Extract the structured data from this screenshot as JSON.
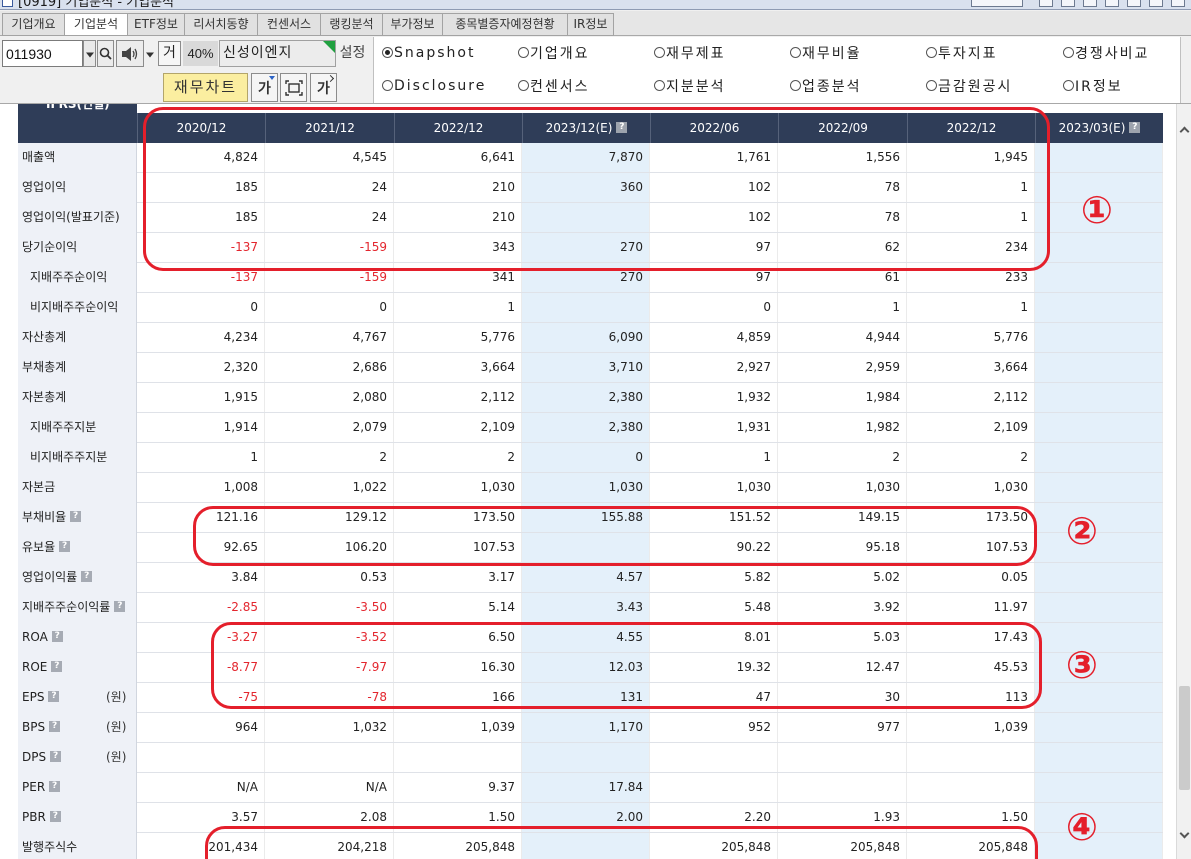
{
  "window": {
    "title": "[0919] 기업분석 - 기업분석"
  },
  "tabs": [
    {
      "label": "기업개요"
    },
    {
      "label": "기업분석",
      "active": true
    },
    {
      "label": "ETF정보"
    },
    {
      "label": "리서치동향"
    },
    {
      "label": "컨센서스"
    },
    {
      "label": "랭킹분석"
    },
    {
      "label": "부가정보"
    },
    {
      "label": "종목별증자예정현황"
    },
    {
      "label": "IR정보"
    }
  ],
  "toolbar": {
    "stock_code": "011930",
    "quote_button": "거",
    "ratio": "40%",
    "company_name": "신성이엔지",
    "settings_label": "설정",
    "chart_button": "재무차트",
    "font_button": "가",
    "font_button_2": "가"
  },
  "view_options": [
    {
      "label": "Snapshot",
      "selected": true
    },
    {
      "label": "기업개요"
    },
    {
      "label": "재무제표"
    },
    {
      "label": "재무비율"
    },
    {
      "label": "투자지표"
    },
    {
      "label": "경쟁사비교"
    },
    {
      "label": "Disclosure"
    },
    {
      "label": "컨센서스"
    },
    {
      "label": "지분분석"
    },
    {
      "label": "업종분석"
    },
    {
      "label": "금감원공시"
    },
    {
      "label": "IR정보"
    }
  ],
  "table": {
    "corner_label": "IFRS(연결)",
    "columns": [
      {
        "label": "2020/12"
      },
      {
        "label": "2021/12"
      },
      {
        "label": "2022/12"
      },
      {
        "label": "2023/12(E)",
        "estimate": true,
        "help": true
      },
      {
        "label": "2022/06"
      },
      {
        "label": "2022/09"
      },
      {
        "label": "2022/12"
      },
      {
        "label": "2023/03(E)",
        "estimate": true,
        "help": true
      }
    ],
    "rows": [
      {
        "label": "매출액",
        "values": [
          "4,824",
          "4,545",
          "6,641",
          "7,870",
          "1,761",
          "1,556",
          "1,945",
          ""
        ]
      },
      {
        "label": "영업이익",
        "values": [
          "185",
          "24",
          "210",
          "360",
          "102",
          "78",
          "1",
          ""
        ]
      },
      {
        "label": "영업이익(발표기준)",
        "values": [
          "185",
          "24",
          "210",
          "",
          "102",
          "78",
          "1",
          ""
        ]
      },
      {
        "label": "당기순이익",
        "values": [
          "-137",
          "-159",
          "343",
          "270",
          "97",
          "62",
          "234",
          ""
        ]
      },
      {
        "label": "지배주주순이익",
        "indent": true,
        "values": [
          "-137",
          "-159",
          "341",
          "270",
          "97",
          "61",
          "233",
          ""
        ]
      },
      {
        "label": "비지배주주순이익",
        "indent": true,
        "values": [
          "0",
          "0",
          "1",
          "",
          "0",
          "1",
          "1",
          ""
        ]
      },
      {
        "label": "자산총계",
        "values": [
          "4,234",
          "4,767",
          "5,776",
          "6,090",
          "4,859",
          "4,944",
          "5,776",
          ""
        ]
      },
      {
        "label": "부채총계",
        "values": [
          "2,320",
          "2,686",
          "3,664",
          "3,710",
          "2,927",
          "2,959",
          "3,664",
          ""
        ]
      },
      {
        "label": "자본총계",
        "values": [
          "1,915",
          "2,080",
          "2,112",
          "2,380",
          "1,932",
          "1,984",
          "2,112",
          ""
        ]
      },
      {
        "label": "지배주주지분",
        "indent": true,
        "values": [
          "1,914",
          "2,079",
          "2,109",
          "2,380",
          "1,931",
          "1,982",
          "2,109",
          ""
        ]
      },
      {
        "label": "비지배주주지분",
        "indent": true,
        "values": [
          "1",
          "2",
          "2",
          "0",
          "1",
          "2",
          "2",
          ""
        ]
      },
      {
        "label": "자본금",
        "values": [
          "1,008",
          "1,022",
          "1,030",
          "1,030",
          "1,030",
          "1,030",
          "1,030",
          ""
        ]
      },
      {
        "label": "부채비율",
        "help": true,
        "values": [
          "121.16",
          "129.12",
          "173.50",
          "155.88",
          "151.52",
          "149.15",
          "173.50",
          ""
        ]
      },
      {
        "label": "유보율",
        "help": true,
        "values": [
          "92.65",
          "106.20",
          "107.53",
          "",
          "90.22",
          "95.18",
          "107.53",
          ""
        ]
      },
      {
        "label": "영업이익률",
        "help": true,
        "values": [
          "3.84",
          "0.53",
          "3.17",
          "4.57",
          "5.82",
          "5.02",
          "0.05",
          ""
        ]
      },
      {
        "label": "지배주주순이익률",
        "help": true,
        "values": [
          "-2.85",
          "-3.50",
          "5.14",
          "3.43",
          "5.48",
          "3.92",
          "11.97",
          ""
        ]
      },
      {
        "label": "ROA",
        "help": true,
        "values": [
          "-3.27",
          "-3.52",
          "6.50",
          "4.55",
          "8.01",
          "5.03",
          "17.43",
          ""
        ]
      },
      {
        "label": "ROE",
        "help": true,
        "values": [
          "-8.77",
          "-7.97",
          "16.30",
          "12.03",
          "19.32",
          "12.47",
          "45.53",
          ""
        ]
      },
      {
        "label": "EPS",
        "help": true,
        "unit": "(원)",
        "values": [
          "-75",
          "-78",
          "166",
          "131",
          "47",
          "30",
          "113",
          ""
        ]
      },
      {
        "label": "BPS",
        "help": true,
        "unit": "(원)",
        "values": [
          "964",
          "1,032",
          "1,039",
          "1,170",
          "952",
          "977",
          "1,039",
          ""
        ]
      },
      {
        "label": "DPS",
        "help": true,
        "unit": "(원)",
        "values": [
          "",
          "",
          "",
          "",
          "",
          "",
          "",
          ""
        ]
      },
      {
        "label": "PER",
        "help": true,
        "values": [
          "N/A",
          "N/A",
          "9.37",
          "17.84",
          "",
          "",
          "",
          ""
        ]
      },
      {
        "label": "PBR",
        "help": true,
        "values": [
          "3.57",
          "2.08",
          "1.50",
          "2.00",
          "2.20",
          "1.93",
          "1.50",
          ""
        ]
      },
      {
        "label": "발행주식수",
        "values": [
          "201,434",
          "204,218",
          "205,848",
          "",
          "205,848",
          "205,848",
          "205,848",
          ""
        ]
      }
    ]
  },
  "annotations": [
    {
      "label": "①"
    },
    {
      "label": "②"
    },
    {
      "label": "③"
    },
    {
      "label": "④"
    }
  ],
  "icons": {
    "search": "search-icon",
    "speaker": "speaker-icon",
    "fullscreen": "frame-icon",
    "help": "help-icon",
    "dropdown": "chevron-down-icon"
  },
  "colors": {
    "header_bg": "#2f3d58",
    "estimate_bg": "#e4f0fa",
    "negative": "#e3262e",
    "annotation": "#e41f2b",
    "chart_button_bg": "#fbeea0",
    "label_bg": "#eef1f7"
  }
}
